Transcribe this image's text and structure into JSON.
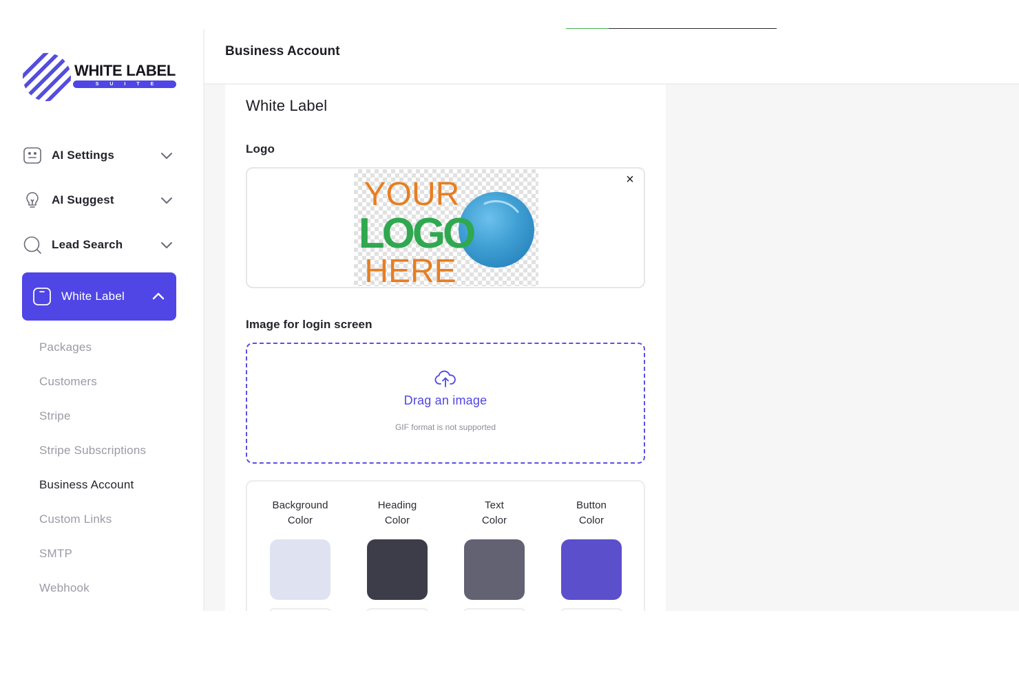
{
  "brand": {
    "name": "WHITE LABEL",
    "tagline": "SUITE",
    "accent": "#4f46e5"
  },
  "sidebar": {
    "items": [
      {
        "label": "AI Settings",
        "icon": "robot-face-icon",
        "expanded": false
      },
      {
        "label": "AI Suggest",
        "icon": "lightbulb-icon",
        "expanded": false
      },
      {
        "label": "Lead Search",
        "icon": "search-icon",
        "expanded": false
      },
      {
        "label": "White Label",
        "icon": "square-tag-icon",
        "expanded": true
      }
    ],
    "subitems": [
      {
        "label": "Packages"
      },
      {
        "label": "Customers"
      },
      {
        "label": "Stripe"
      },
      {
        "label": "Stripe Subscriptions"
      },
      {
        "label": "Business Account",
        "current": true
      },
      {
        "label": "Custom Links"
      },
      {
        "label": "SMTP"
      },
      {
        "label": "Webhook"
      }
    ]
  },
  "header": {
    "title": "Business Account"
  },
  "card": {
    "title": "White Label",
    "logo": {
      "label": "Logo",
      "placeholder_lines": [
        "YOUR",
        "LOGO",
        "HERE"
      ],
      "close": "×"
    },
    "login_image": {
      "label": "Image for login screen",
      "drop_text": "Drag an image",
      "hint": "GIF format is not supported"
    },
    "colors": [
      {
        "label_line1": "Background",
        "label_line2": "Color",
        "value": "#dfe2f1"
      },
      {
        "label_line1": "Heading",
        "label_line2": "Color",
        "value": "#3d3d4a"
      },
      {
        "label_line1": "Text",
        "label_line2": "Color",
        "value": "#636273"
      },
      {
        "label_line1": "Button",
        "label_line2": "Color",
        "value": "#5b4fcb"
      }
    ]
  }
}
